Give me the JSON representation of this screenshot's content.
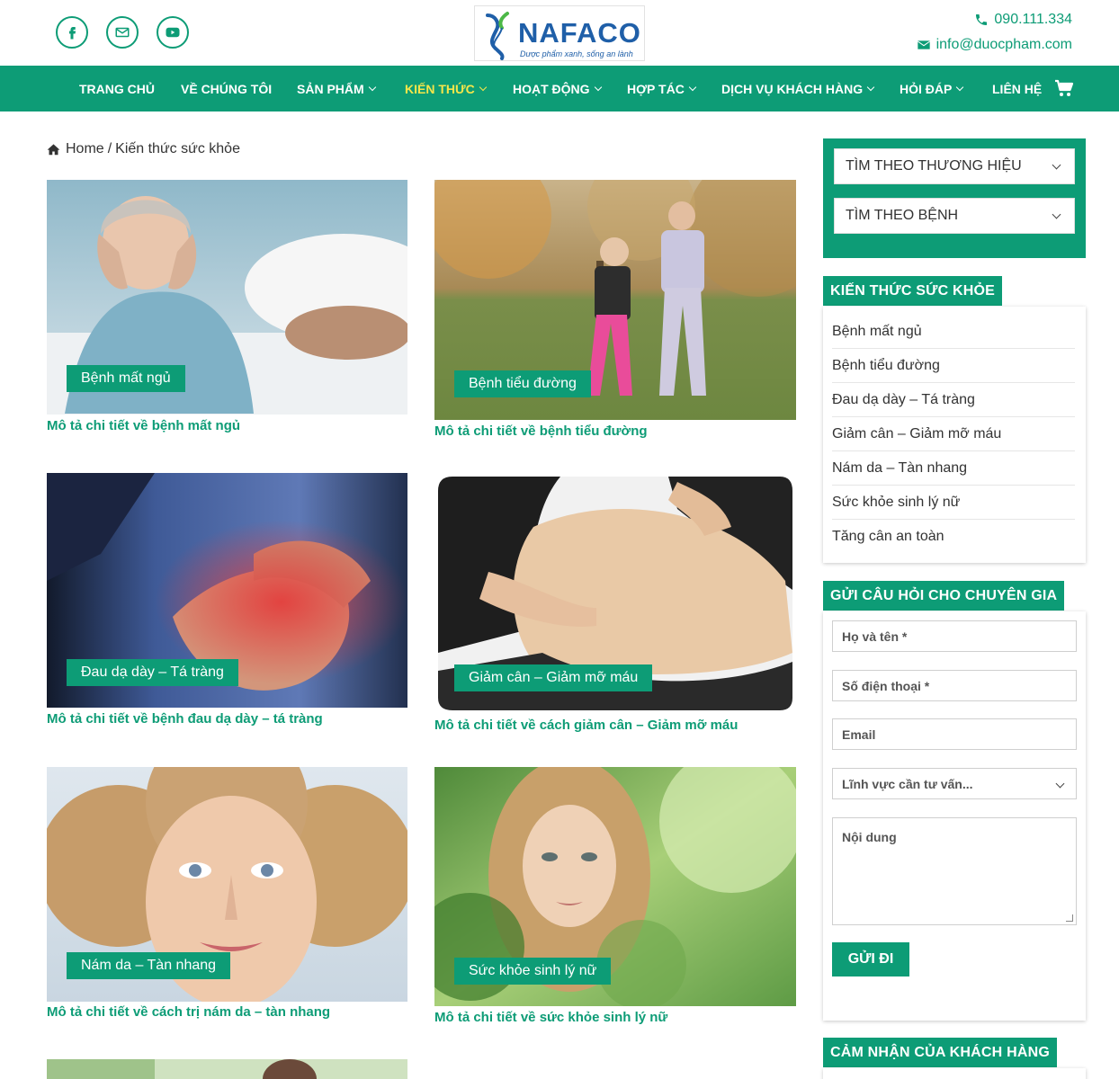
{
  "header": {
    "logo": {
      "brand": "NAFACO",
      "slogan": "Dược phẩm xanh, sống an lành"
    },
    "social": [
      {
        "name": "facebook-icon"
      },
      {
        "name": "email-icon"
      },
      {
        "name": "youtube-icon"
      }
    ],
    "phone": "090.111.334",
    "email": "info@duocpham.com"
  },
  "nav": {
    "items": [
      {
        "label": "TRANG CHỦ",
        "has_dropdown": false
      },
      {
        "label": "VỀ CHÚNG TÔI",
        "has_dropdown": false
      },
      {
        "label": "SẢN PHẨM",
        "has_dropdown": true
      },
      {
        "label": "KIẾN THỨC",
        "has_dropdown": true,
        "active": true
      },
      {
        "label": "HOẠT ĐỘNG",
        "has_dropdown": true
      },
      {
        "label": "HỢP TÁC",
        "has_dropdown": true
      },
      {
        "label": "DỊCH VỤ KHÁCH HÀNG",
        "has_dropdown": true
      },
      {
        "label": "HỎI ĐÁP",
        "has_dropdown": true
      },
      {
        "label": "LIÊN HỆ",
        "has_dropdown": false
      }
    ],
    "cart_icon": "cart-icon"
  },
  "breadcrumb": {
    "home": "Home",
    "separator": "/",
    "current": "Kiến thức sức khỏe"
  },
  "posts": [
    {
      "tag": "Bệnh mất ngủ",
      "desc": "Mô tả chi tiết về bệnh mất ngủ"
    },
    {
      "tag": "Bệnh tiểu đường",
      "desc": "Mô tả chi tiết về bệnh tiểu đường"
    },
    {
      "tag": "Đau dạ dày – Tá tràng",
      "desc": "Mô tả chi tiết về bệnh đau dạ dày – tá tràng"
    },
    {
      "tag": "Giảm cân – Giảm mỡ máu",
      "desc": "Mô tả chi tiết về cách giảm cân – Giảm mỡ máu"
    },
    {
      "tag": "Nám da – Tàn nhang",
      "desc": "Mô tả chi tiết về cách trị nám da – tàn nhang"
    },
    {
      "tag": "Sức khỏe sinh lý nữ",
      "desc": "Mô tả chi tiết về sức khỏe sinh lý nữ"
    }
  ],
  "sidebar": {
    "filters": [
      "TÌM THEO THƯƠNG HIỆU",
      "TÌM THEO BỆNH"
    ],
    "categories_title": "KIẾN THỨC SỨC KHỎE",
    "categories": [
      "Bệnh mất ngủ",
      "Bệnh tiểu đường",
      "Đau dạ dày – Tá tràng",
      "Giảm cân – Giảm mỡ máu",
      "Nám da – Tàn nhang",
      "Sức khỏe sinh lý nữ",
      "Tăng cân an toàn"
    ],
    "form": {
      "title": "GỬI CÂU HỎI CHO CHUYÊN GIA",
      "name_placeholder": "Họ và tên *",
      "phone_placeholder": "Số điện thoại *",
      "email_placeholder": "Email",
      "field_select": "Lĩnh vực cần tư vấn...",
      "content_placeholder": "Nội dung",
      "submit": "GỬI ĐI"
    },
    "testimonials_title": "CẢM NHẬN CỦA KHÁCH HÀNG"
  },
  "colors": {
    "primary": "#0d9c76",
    "active_nav": "#f6e64a",
    "logo_blue": "#1f5fa8"
  }
}
